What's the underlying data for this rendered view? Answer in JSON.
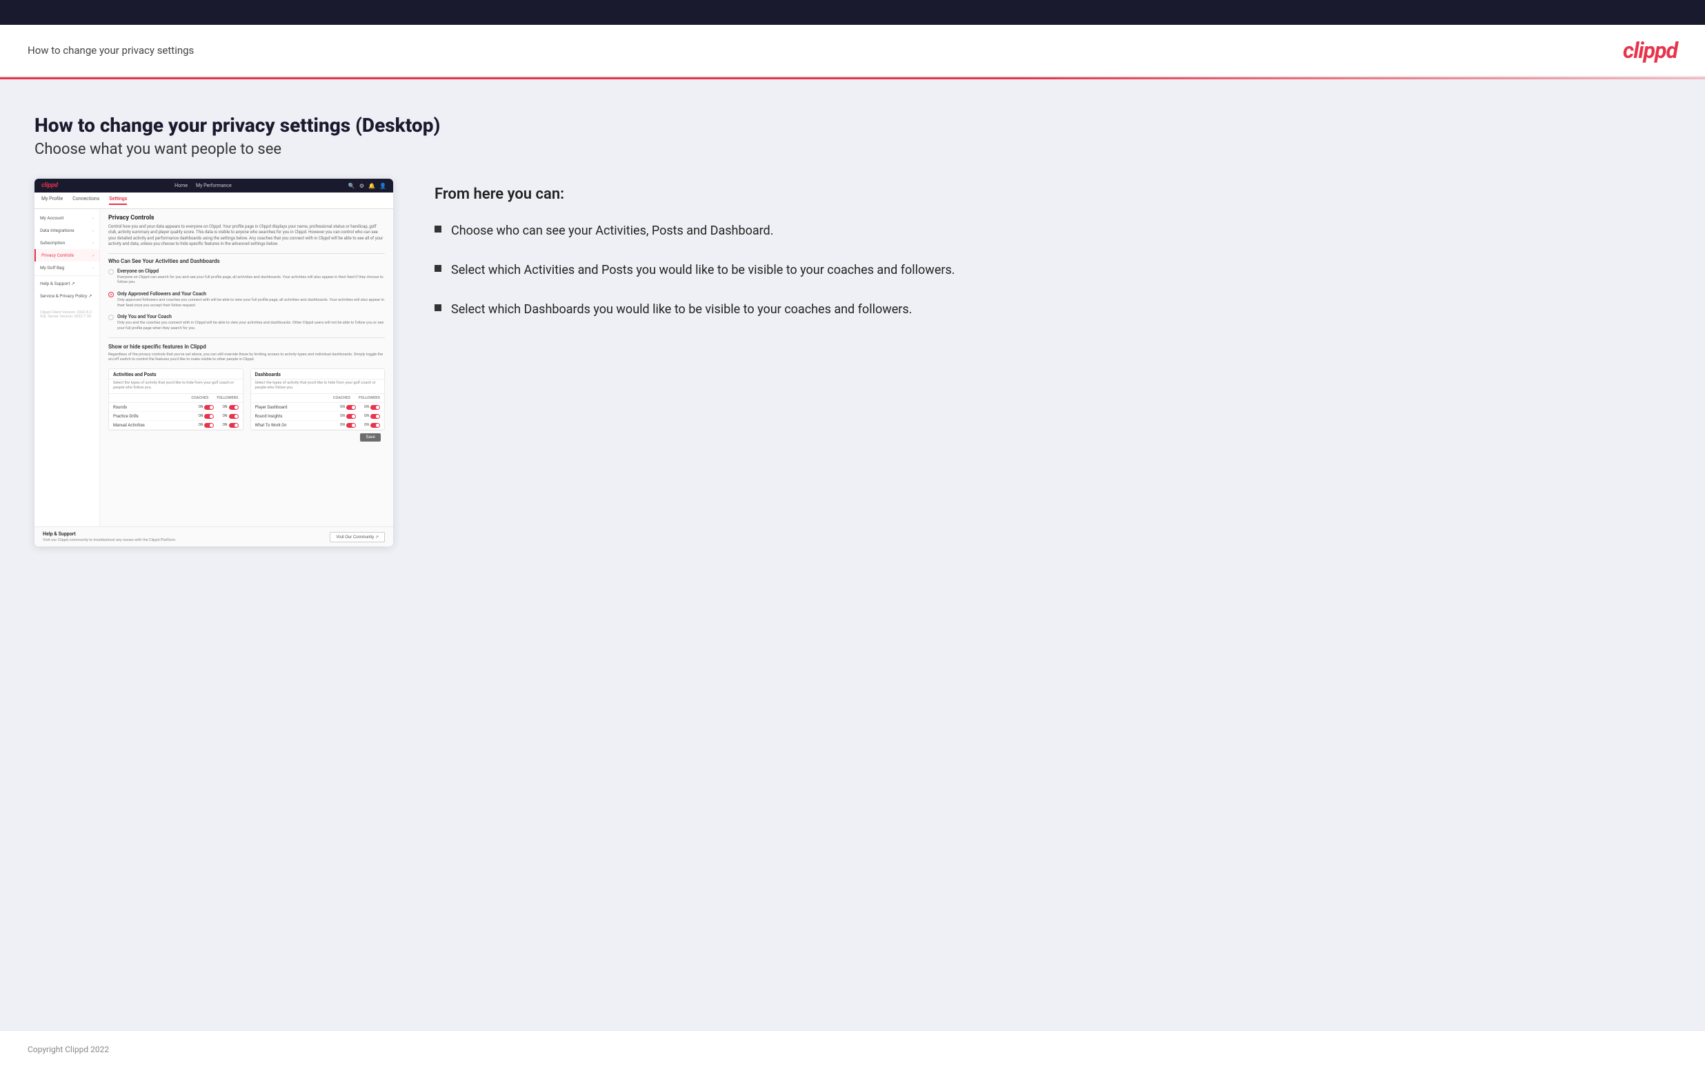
{
  "header": {
    "title": "How to change your privacy settings",
    "logo": "clippd"
  },
  "page": {
    "main_heading": "How to change your privacy settings (Desktop)",
    "sub_heading": "Choose what you want people to see"
  },
  "mockup": {
    "navbar": {
      "logo": "clippd",
      "links": [
        "Home",
        "My Performance"
      ],
      "icons": [
        "🔍",
        "⚙",
        "🔔",
        "👤"
      ]
    },
    "subnav": {
      "items": [
        "My Profile",
        "Connections",
        "Settings"
      ],
      "active": "Settings"
    },
    "sidebar": {
      "items": [
        {
          "label": "My Account",
          "active": false
        },
        {
          "label": "Data Integrations",
          "active": false
        },
        {
          "label": "Subscription",
          "active": false
        },
        {
          "label": "Privacy Controls",
          "active": true
        },
        {
          "label": "My Golf Bag",
          "active": false
        },
        {
          "label": "Help & Support ↗",
          "active": false
        },
        {
          "label": "Service & Privacy Policy ↗",
          "active": false
        }
      ],
      "version": {
        "client": "Clippd Client Version: 2022.8.2",
        "sql": "SQL Server Version: 2022.7.38"
      }
    },
    "privacy_controls": {
      "section_title": "Privacy Controls",
      "section_desc": "Control how you and your data appears to everyone on Clippd. Your profile page in Clippd displays your name, professional status or handicap, golf club, activity summary and player quality score. This data is visible to anyone who searches for you in Clippd. However you can control who can see your detailed activity and performance dashboards using the settings below. Any coaches that you connect with in Clippd will be able to see all of your activity and data, unless you choose to hide specific features in the advanced settings below.",
      "who_can_see_title": "Who Can See Your Activities and Dashboards",
      "radio_options": [
        {
          "id": "everyone",
          "label": "Everyone on Clippd",
          "desc": "Everyone on Clippd can search for you and see your full profile page, all activities and dashboards. Your activities will also appear in their feed if they choose to follow you.",
          "selected": false
        },
        {
          "id": "followers",
          "label": "Only Approved Followers and Your Coach",
          "desc": "Only approved followers and coaches you connect with will be able to view your full profile page, all activities and dashboards. Your activities will also appear in their feed once you accept their follow request.",
          "selected": true
        },
        {
          "id": "coach_only",
          "label": "Only You and Your Coach",
          "desc": "Only you and the coaches you connect with in Clippd will be able to view your activities and dashboards. Other Clippd users will not be able to follow you or see your full profile page when they search for you.",
          "selected": false
        }
      ],
      "show_or_hide_title": "Show or hide specific features in Clippd",
      "show_or_hide_desc": "Regardless of the privacy controls that you've set above, you can still override these by limiting access to activity types and individual dashboards. Simply toggle the on/off switch to control the features you'd like to make visible to other people in Clippd.",
      "activities_posts": {
        "title": "Activities and Posts",
        "desc": "Select the types of activity that you'd like to hide from your golf coach or people who follow you.",
        "col_coaches": "COACHES",
        "col_followers": "FOLLOWERS",
        "rows": [
          {
            "label": "Rounds",
            "coaches_on": true,
            "followers_on": true
          },
          {
            "label": "Practice Drills",
            "coaches_on": true,
            "followers_on": true
          },
          {
            "label": "Manual Activities",
            "coaches_on": true,
            "followers_on": true
          }
        ]
      },
      "dashboards": {
        "title": "Dashboards",
        "desc": "Select the types of activity that you'd like to hide from your golf coach or people who follow you.",
        "col_coaches": "COACHES",
        "col_followers": "FOLLOWERS",
        "rows": [
          {
            "label": "Player Dashboard",
            "coaches_on": true,
            "followers_on": true
          },
          {
            "label": "Round Insights",
            "coaches_on": true,
            "followers_on": true
          },
          {
            "label": "What To Work On",
            "coaches_on": true,
            "followers_on": true
          }
        ]
      },
      "save_label": "Save"
    },
    "help": {
      "title": "Help & Support",
      "desc": "Visit our Clippd community to troubleshoot any issues with the Clippd Platform.",
      "button": "Visit Our Community ↗"
    }
  },
  "right_panel": {
    "from_here_title": "From here you can:",
    "bullets": [
      {
        "text": "Choose who can see your Activities, Posts and Dashboard."
      },
      {
        "text": "Select which Activities and Posts you would like to be visible to your coaches and followers."
      },
      {
        "text": "Select which Dashboards you would like to be visible to your coaches and followers."
      }
    ]
  },
  "footer": {
    "copyright": "Copyright Clippd 2022"
  }
}
